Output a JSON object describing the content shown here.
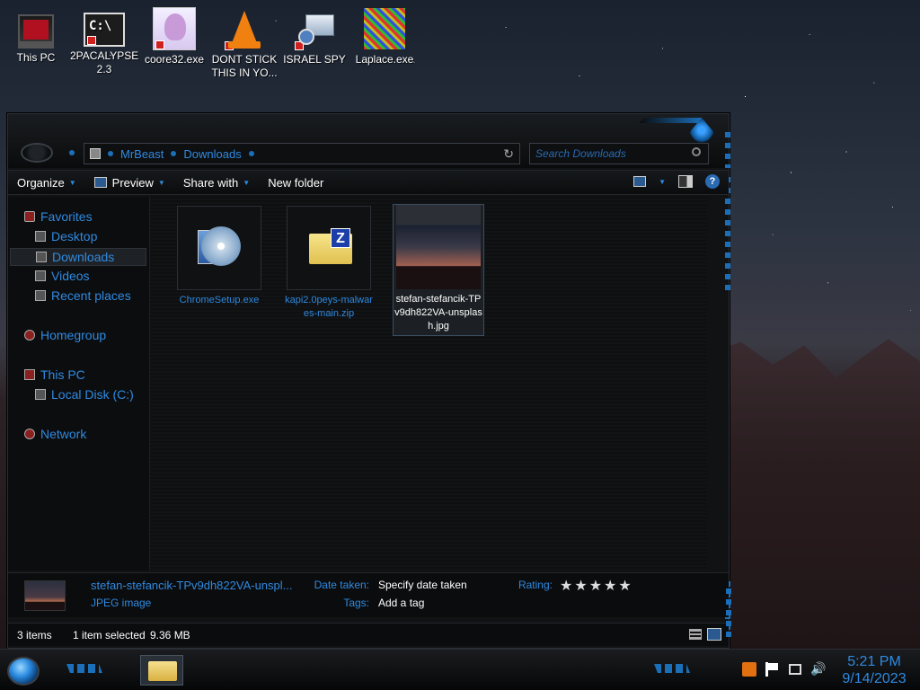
{
  "desktop": {
    "icons": [
      {
        "label": "This PC"
      },
      {
        "label": "2PACALYPSE 2.3"
      },
      {
        "label": "coore32.exe"
      },
      {
        "label": "DONT STICK THIS IN YO..."
      },
      {
        "label": "ISRAEL SPY"
      },
      {
        "label": "Laplace.exe"
      }
    ]
  },
  "window": {
    "address": {
      "crumbs": [
        "MrBeast",
        "Downloads"
      ],
      "refresh_glyph": "↻"
    },
    "search": {
      "placeholder": "Search Downloads"
    },
    "toolbar": {
      "organize": "Organize",
      "preview": "Preview",
      "share_with": "Share with",
      "new_folder": "New folder",
      "help": "?"
    },
    "sidebar": {
      "favorites": "Favorites",
      "desktop": "Desktop",
      "downloads": "Downloads",
      "videos": "Videos",
      "recent": "Recent places",
      "homegroup": "Homegroup",
      "this_pc": "This PC",
      "local_disk": "Local Disk (C:)",
      "network": "Network"
    },
    "files": [
      {
        "name": "ChromeSetup.exe"
      },
      {
        "name": "kapi2.0peys-malwares-main.zip"
      },
      {
        "name": "stefan-stefancik-TPv9dh822VA-unsplash.jpg"
      }
    ],
    "details": {
      "name": "stefan-stefancik-TPv9dh822VA-unspl...",
      "type": "JPEG image",
      "date_label": "Date taken:",
      "date_value": "Specify date taken",
      "tags_label": "Tags:",
      "tags_value": "Add a tag",
      "rating_label": "Rating:",
      "rating_stars": "★★★★★"
    },
    "status": {
      "items": "3 items",
      "selected": "1 item selected",
      "size": "9.36 MB"
    }
  },
  "taskbar": {
    "time": "5:21 PM",
    "date": "9/14/2023",
    "volume_glyph": "🔊"
  }
}
